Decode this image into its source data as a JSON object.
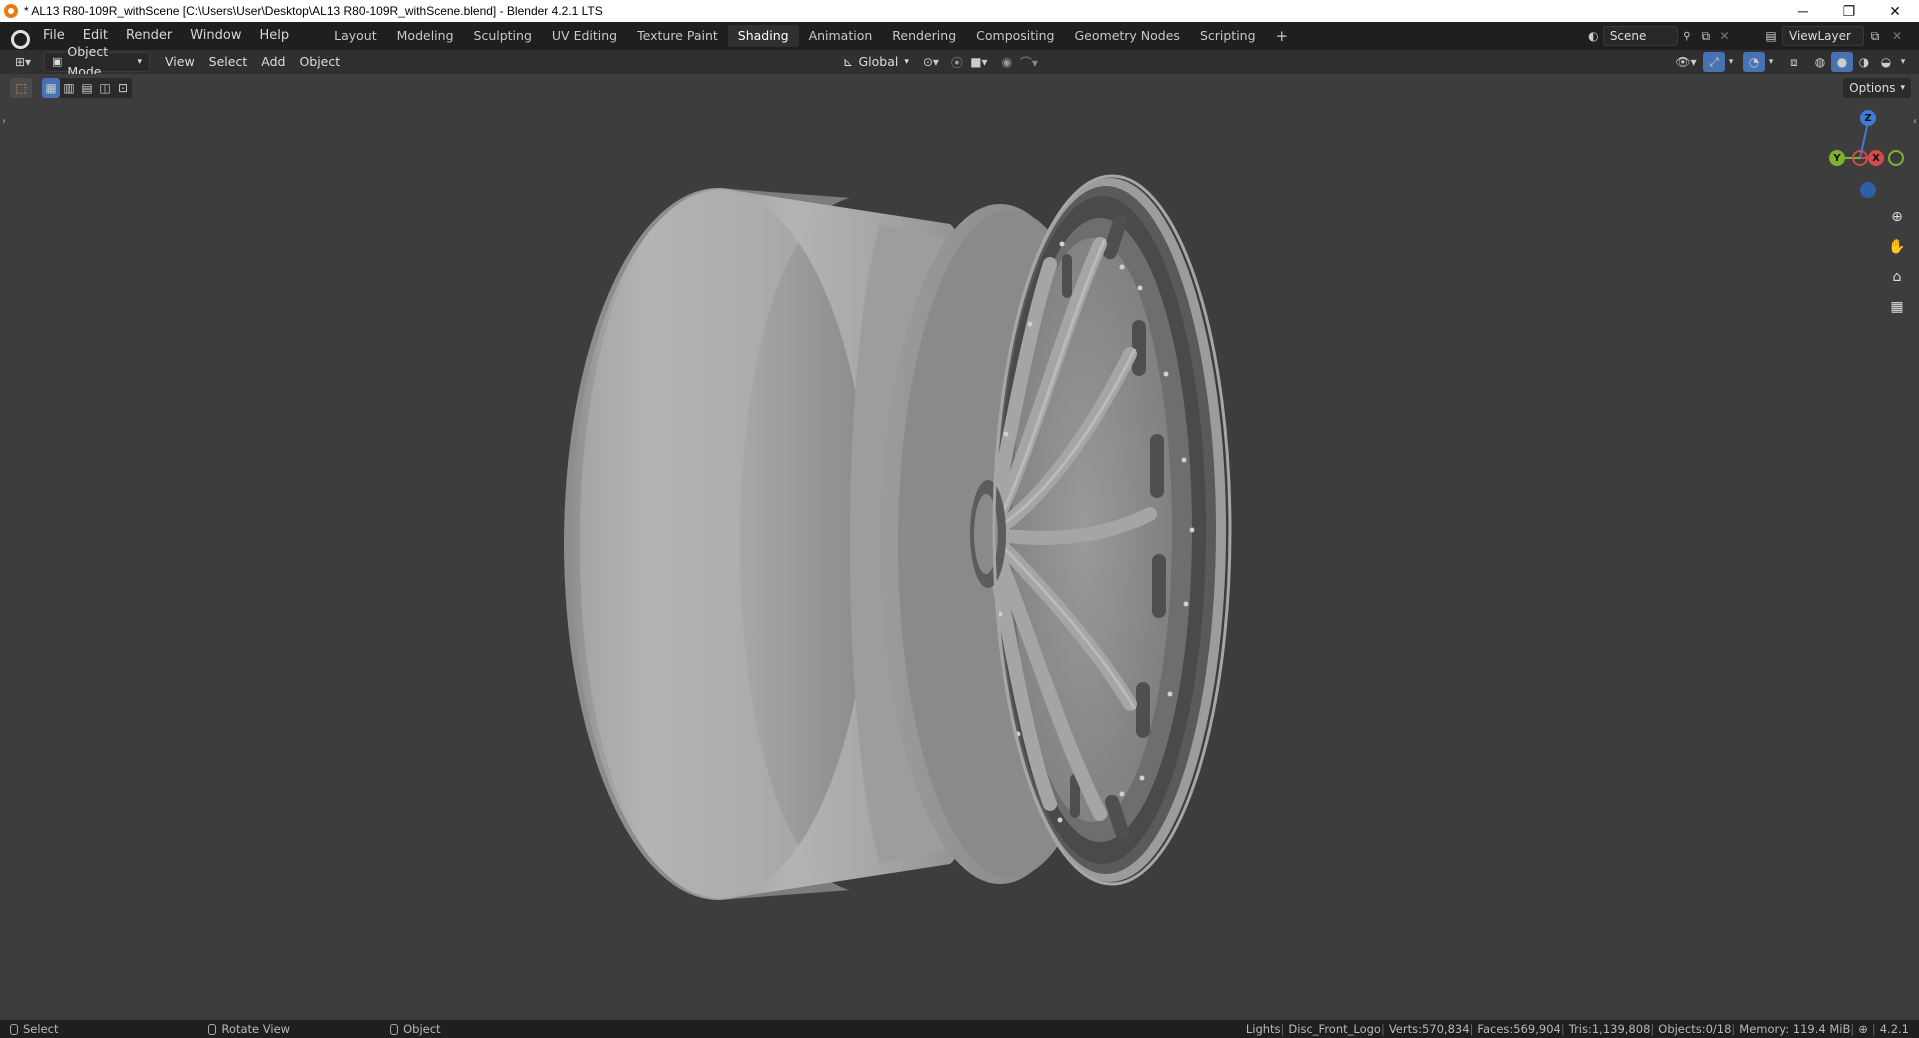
{
  "window": {
    "title": "* AL13 R80-109R_withScene [C:\\Users\\User\\Desktop\\AL13 R80-109R_withScene.blend] - Blender 4.2.1 LTS",
    "controls": [
      "─",
      "❐",
      "✕"
    ]
  },
  "menu": {
    "items": [
      "File",
      "Edit",
      "Render",
      "Window",
      "Help"
    ]
  },
  "workspaces": {
    "tabs": [
      "Layout",
      "Modeling",
      "Sculpting",
      "UV Editing",
      "Texture Paint",
      "Shading",
      "Animation",
      "Rendering",
      "Compositing",
      "Geometry Nodes",
      "Scripting"
    ],
    "active": "Shading",
    "add": "+"
  },
  "scene": {
    "name": "Scene",
    "view_layer": "ViewLayer"
  },
  "header": {
    "mode": "Object Mode",
    "view": "View",
    "select": "Select",
    "add": "Add",
    "object": "Object",
    "orientation": "Global",
    "options": "Options"
  },
  "gizmo": {
    "z": "Z",
    "y": "Y",
    "x": "X"
  },
  "status": {
    "select": "Select",
    "rotate": "Rotate View",
    "object": "Object",
    "collection": "Lights",
    "active_object": "Disc_Front_Logo",
    "verts": "Verts:570,834",
    "faces": "Faces:569,904",
    "tris": "Tris:1,139,808",
    "objects": "Objects:0/18",
    "memory": "Memory: 119.4 MiB",
    "version": "4.2.1"
  },
  "colors": {
    "active_tab": "#303030",
    "axis_x": "#d34a4a",
    "axis_y": "#7fb22c",
    "axis_z": "#3e7ad6",
    "accent": "#4772b3"
  },
  "icons": [
    "blender-icon",
    "editor-type-icon",
    "object-mode-icon",
    "select-box-icon",
    "transform-pivot-icon",
    "snap-icon",
    "proportional-icon",
    "visibility-icon",
    "gizmo-icon",
    "overlay-icon",
    "xray-icon",
    "wireframe-shading-icon",
    "solid-shading-icon",
    "material-shading-icon",
    "rendered-shading-icon",
    "zoom-icon",
    "pan-hand-icon",
    "camera-icon",
    "perspective-grid-icon"
  ]
}
